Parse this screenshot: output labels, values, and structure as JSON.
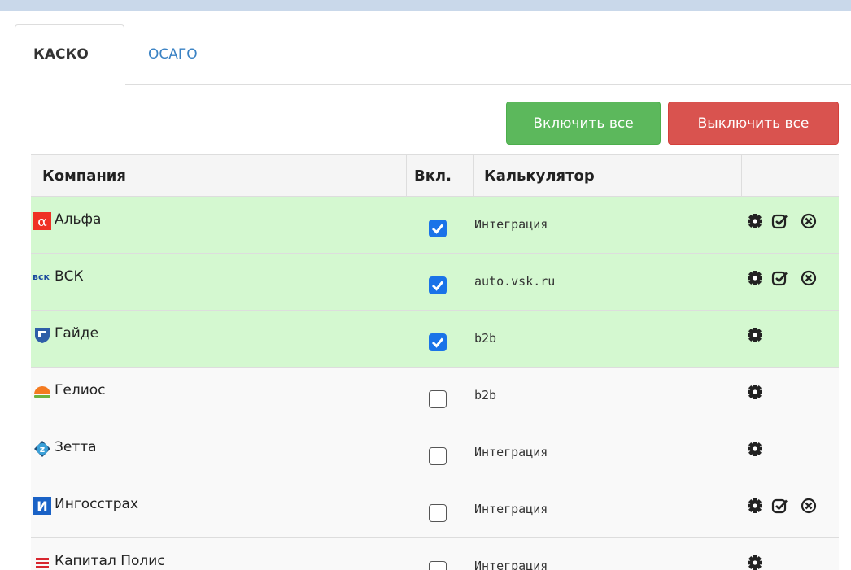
{
  "tabs": [
    {
      "label": "КАСКО",
      "active": true
    },
    {
      "label": "ОСАГО",
      "active": false
    }
  ],
  "toolbar": {
    "enable_all": "Включить все",
    "disable_all": "Выключить все",
    "colors": {
      "green": "#5cb85c",
      "red": "#d9534f"
    }
  },
  "table": {
    "headers": {
      "company": "Компания",
      "enabled": "Вкл.",
      "calculator": "Калькулятор",
      "actions": ""
    },
    "rows": [
      {
        "company": "Альфа",
        "logo": "alfa-logo",
        "enabled": true,
        "calculator": "Интеграция",
        "actions": [
          "gear-icon",
          "check-icon",
          "close-icon"
        ]
      },
      {
        "company": "ВСК",
        "logo": "vsk-logo",
        "logo_text": "вск",
        "enabled": true,
        "calculator": "auto.vsk.ru",
        "actions": [
          "gear-icon",
          "check-icon",
          "close-icon"
        ]
      },
      {
        "company": "Гайде",
        "logo": "gayde-logo",
        "enabled": true,
        "calculator": "b2b",
        "actions": [
          "gear-icon"
        ]
      },
      {
        "company": "Гелиос",
        "logo": "gelios-logo",
        "enabled": false,
        "calculator": "b2b",
        "actions": [
          "gear-icon"
        ]
      },
      {
        "company": "Зетта",
        "logo": "zetta-logo",
        "logo_text": "z",
        "enabled": false,
        "calculator": "Интеграция",
        "actions": [
          "gear-icon"
        ]
      },
      {
        "company": "Ингосстрах",
        "logo": "ingos-logo",
        "logo_text": "И",
        "enabled": false,
        "calculator": "Интеграция",
        "actions": [
          "gear-icon",
          "check-icon",
          "close-icon"
        ]
      },
      {
        "company": "Капитал Полис",
        "logo": "kapital-logo",
        "enabled": false,
        "calculator": "Интеграция",
        "actions": [
          "gear-icon"
        ]
      }
    ]
  }
}
